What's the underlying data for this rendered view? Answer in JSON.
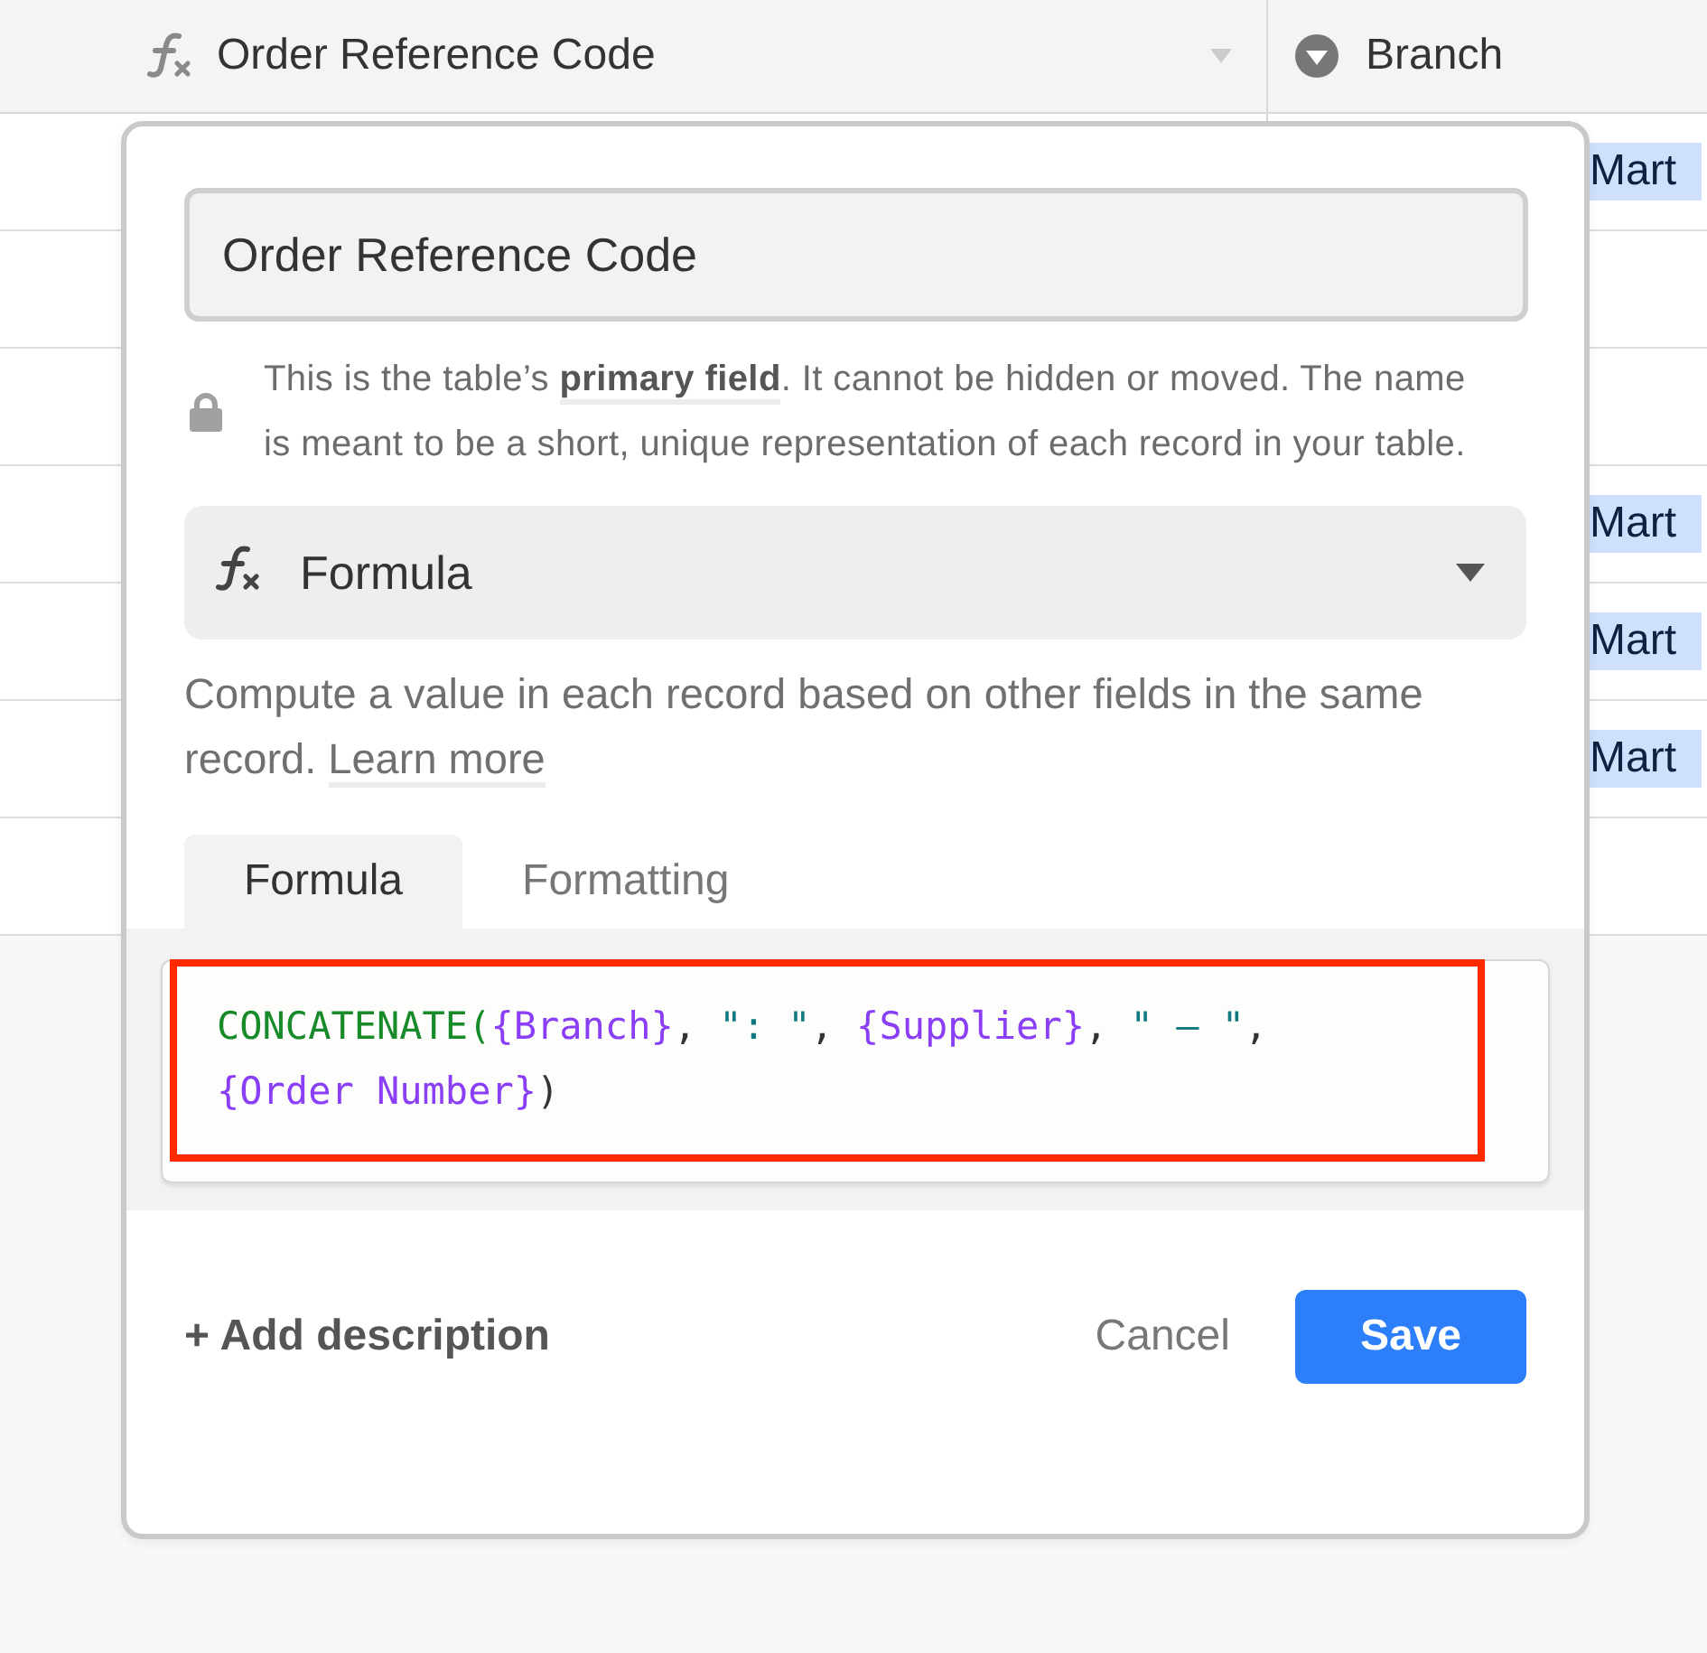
{
  "grid": {
    "columns": [
      {
        "label": "Order Reference Code"
      },
      {
        "label": "Branch"
      }
    ],
    "rows": [
      {
        "branch": "Mart"
      },
      {
        "branch": ""
      },
      {
        "branch": ""
      },
      {
        "branch": "Mart"
      },
      {
        "branch": "Mart"
      },
      {
        "branch": "Mart"
      },
      {
        "branch": ""
      }
    ]
  },
  "field_editor": {
    "name_value": "Order Reference Code",
    "primary_note": "This is the table’s **primary field**. It cannot be hidden or moved. The name is meant to be a short, unique representation of each record in your table.",
    "type_select": {
      "label": "Formula"
    },
    "type_description": "Compute a value in each record based on other fields in the same record.",
    "learn_more": "Learn more",
    "tabs": [
      {
        "label": "Formula",
        "selected": true
      },
      {
        "label": "Formatting",
        "selected": false
      }
    ],
    "formula_lines": [
      [
        {
          "kind": "function",
          "text": "CONCATENATE("
        },
        {
          "kind": "field",
          "text": "{Branch}"
        },
        {
          "kind": "punct",
          "text": ", "
        },
        {
          "kind": "string",
          "text": "\": \""
        },
        {
          "kind": "punct",
          "text": ", "
        },
        {
          "kind": "field",
          "text": "{Supplier}"
        },
        {
          "kind": "punct",
          "text": ", "
        },
        {
          "kind": "string",
          "text": "\" – \""
        },
        {
          "kind": "punct",
          "text": ","
        }
      ],
      [
        {
          "kind": "field",
          "text": "{Order Number}"
        },
        {
          "kind": "punct",
          "text": ")"
        }
      ]
    ],
    "highlighted": true,
    "add_description": "+ Add description",
    "cancel": "Cancel",
    "save": "Save"
  }
}
